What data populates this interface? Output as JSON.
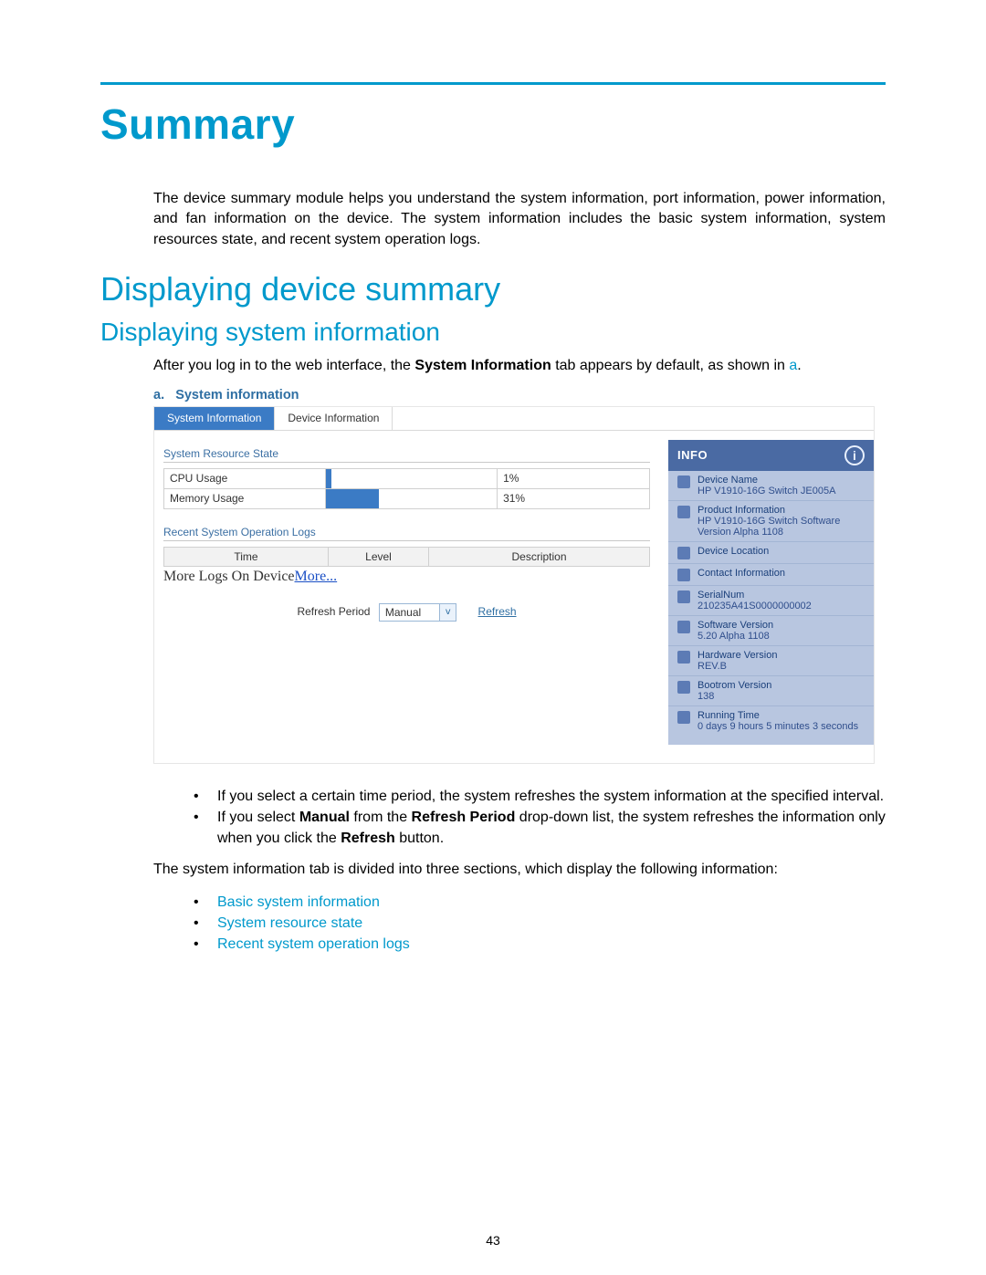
{
  "page": {
    "title": "Summary",
    "intro": "The device summary module helps you understand the system information, port information, power information, and fan information on the device. The system information includes the basic system information, system resources state, and recent system operation logs.",
    "h2": "Displaying device summary",
    "h3": "Displaying system information",
    "after_login_pre": "After you log in to the web interface, the ",
    "after_login_bold": "System Information",
    "after_login_mid": " tab appears by default, as shown in ",
    "after_login_ref": "a",
    "after_login_post": ".",
    "fig_label": "a.",
    "fig_title": "System information",
    "bullets_behavior": [
      {
        "pre": "If you select a certain time period, the system refreshes the system information at the specified interval."
      },
      {
        "pre": "If you select ",
        "b1": "Manual",
        "mid": " from the ",
        "b2": "Refresh Period",
        "mid2": " drop-down list, the system refreshes the information only when you click the ",
        "b3": "Refresh",
        "post": " button."
      }
    ],
    "sections_intro": "The system information tab is divided into three sections, which display the following information:",
    "section_links": [
      "Basic system information",
      "System resource state",
      "Recent system operation logs"
    ],
    "page_number": "43"
  },
  "screenshot": {
    "tabs": [
      {
        "label": "System Information",
        "active": true
      },
      {
        "label": "Device Information",
        "active": false
      }
    ],
    "resource_title": "System Resource State",
    "resources": [
      {
        "label": "CPU Usage",
        "pct": "1%",
        "pct_num": 1
      },
      {
        "label": "Memory Usage",
        "pct": "31%",
        "pct_num": 31
      }
    ],
    "logs_title": "Recent System Operation Logs",
    "logs_columns": [
      "Time",
      "Level",
      "Description"
    ],
    "more_logs_pre": "More Logs On Device",
    "more_logs_link": "More...",
    "refresh_label": "Refresh Period",
    "refresh_selected": "Manual",
    "refresh_link": "Refresh",
    "info": {
      "title": "INFO",
      "items": [
        {
          "label": "Device Name",
          "value": "HP V1910-16G Switch JE005A"
        },
        {
          "label": "Product Information",
          "value": "HP V1910-16G Switch Software Version Alpha 1108"
        },
        {
          "label": "Device Location",
          "value": ""
        },
        {
          "label": "Contact Information",
          "value": ""
        },
        {
          "label": "SerialNum",
          "value": "210235A41S0000000002"
        },
        {
          "label": "Software Version",
          "value": "5.20 Alpha 1108"
        },
        {
          "label": "Hardware Version",
          "value": "REV.B"
        },
        {
          "label": "Bootrom Version",
          "value": "138"
        },
        {
          "label": "Running Time",
          "value": "0 days 9 hours 5 minutes 3 seconds"
        }
      ]
    }
  }
}
